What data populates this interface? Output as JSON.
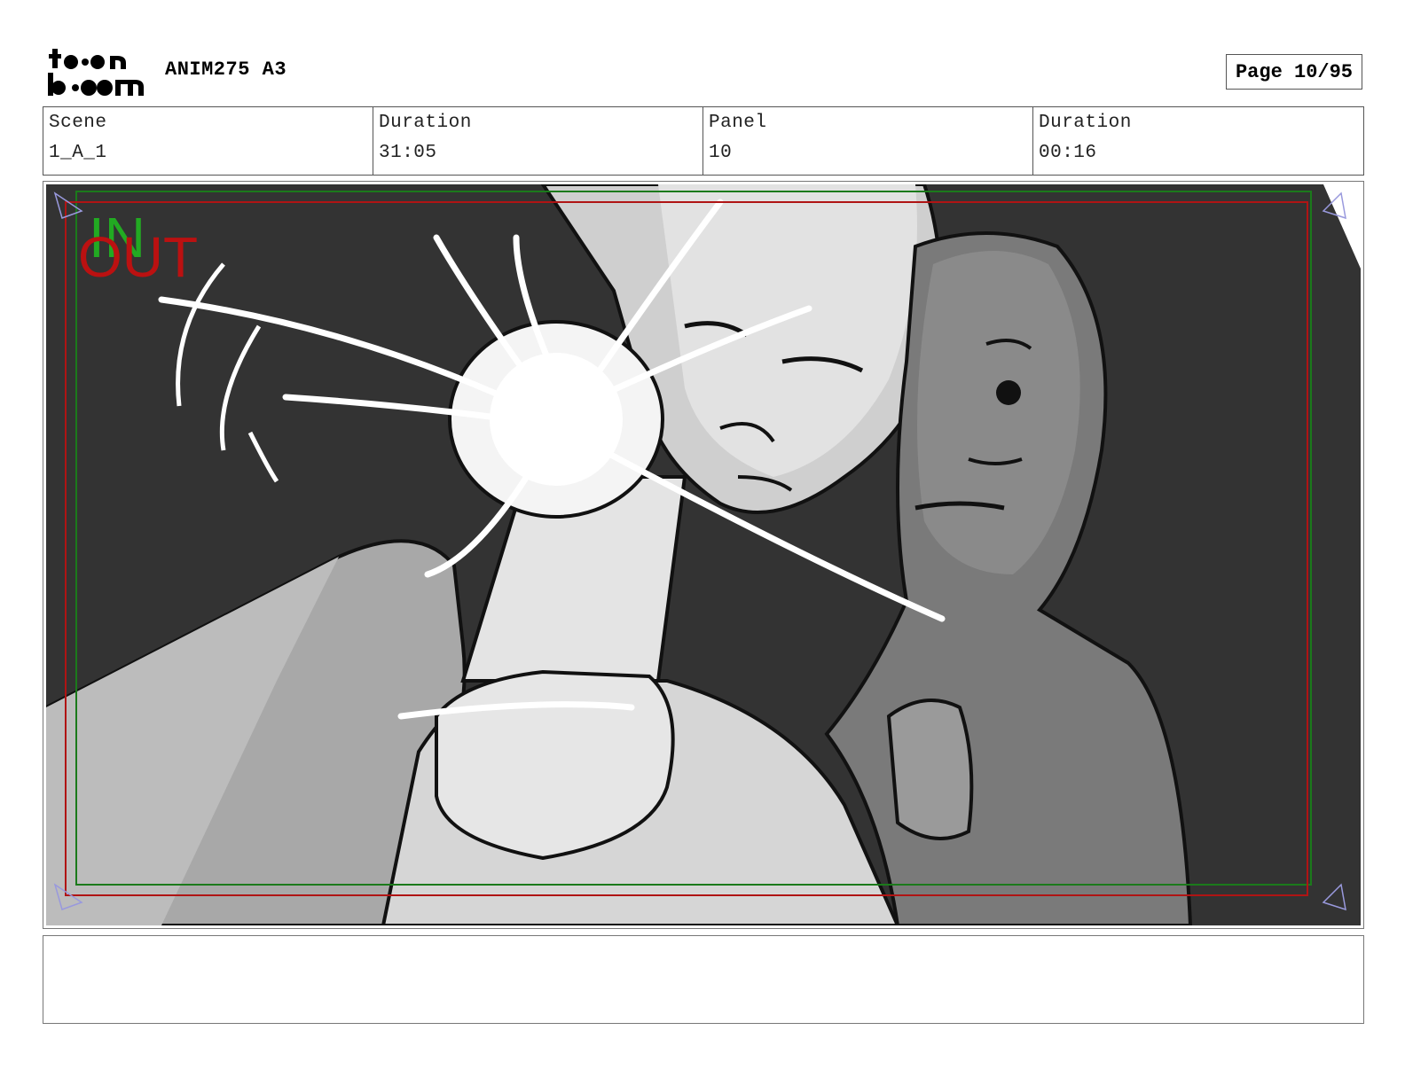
{
  "header": {
    "logo_text": "toon boom",
    "project": "ANIM275 A3",
    "page_label": "Page 10/95"
  },
  "info": {
    "scene_label": "Scene",
    "scene_value": "1_A_1",
    "scene_duration_label": "Duration",
    "scene_duration_value": "31:05",
    "panel_label": "Panel",
    "panel_value": "10",
    "panel_duration_label": "Duration",
    "panel_duration_value": "00:16"
  },
  "panel": {
    "in_label": "IN",
    "out_label": "OUT",
    "in_color": "#22aa22",
    "out_color": "#bb1111",
    "background_color": "#333333"
  },
  "notes": {
    "text": ""
  }
}
